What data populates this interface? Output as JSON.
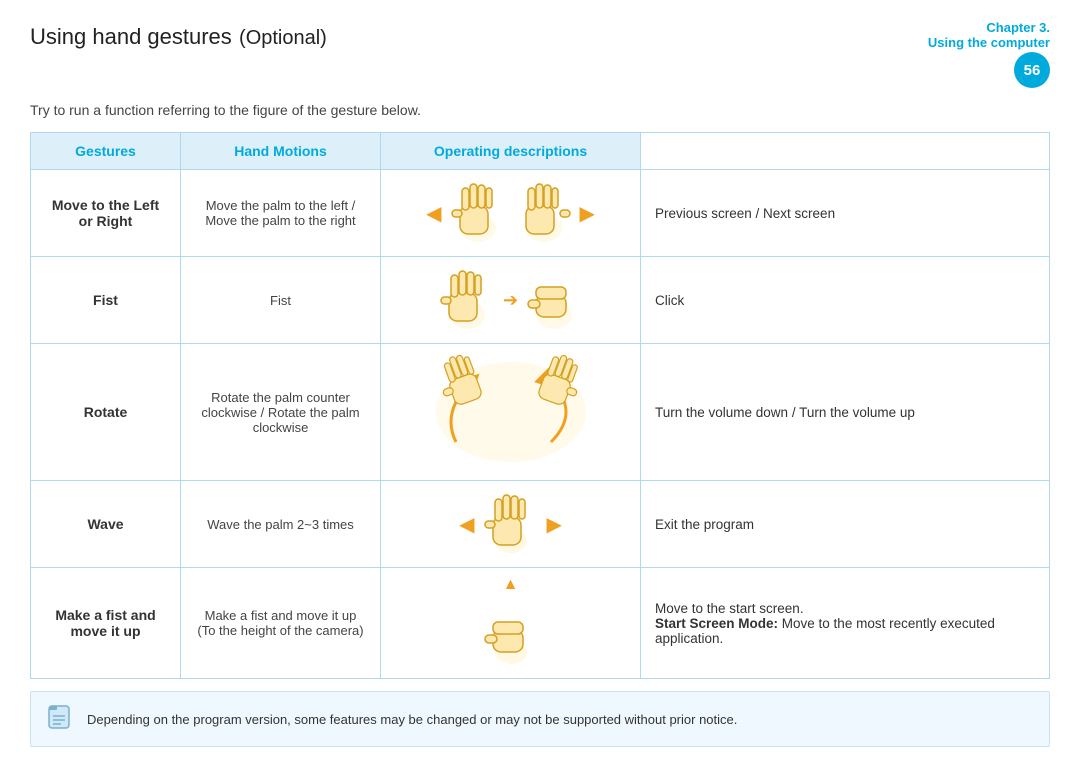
{
  "header": {
    "title": "Using hand gestures",
    "title_optional": "(Optional)",
    "chapter_label": "Chapter 3.",
    "chapter_sub": "Using the computer",
    "page_number": "56"
  },
  "subtitle": "Try to run a function referring to the figure of the gesture below.",
  "table": {
    "columns": [
      "Gestures",
      "Hand Motions",
      "Operating descriptions"
    ],
    "rows": [
      {
        "gesture_name": "Move to the Left or Right",
        "gesture_desc": "Move the palm to the left / Move the palm to the right",
        "motion_type": "left_right",
        "operating_desc": "Previous screen / Next screen",
        "operating_bold": ""
      },
      {
        "gesture_name": "Fist",
        "gesture_desc": "Fist",
        "motion_type": "fist",
        "operating_desc": "Click",
        "operating_bold": ""
      },
      {
        "gesture_name": "Rotate",
        "gesture_desc": "Rotate the palm counter clockwise / Rotate the palm clockwise",
        "motion_type": "rotate",
        "operating_desc": "Turn the volume down / Turn the volume up",
        "operating_bold": ""
      },
      {
        "gesture_name": "Wave",
        "gesture_desc": "Wave the palm 2~3 times",
        "motion_type": "wave",
        "operating_desc": "Exit the program",
        "operating_bold": ""
      },
      {
        "gesture_name": "Make a fist and move it up",
        "gesture_desc": "Make a fist and move it up (To the height of the camera)",
        "motion_type": "fist_up",
        "operating_desc": "Move to the start screen.\nStart Screen Mode: Move to the most recently executed application.",
        "operating_bold": "Start Screen Mode:"
      }
    ]
  },
  "note": "Depending on the program version, some features may be changed or may not be supported without prior notice."
}
